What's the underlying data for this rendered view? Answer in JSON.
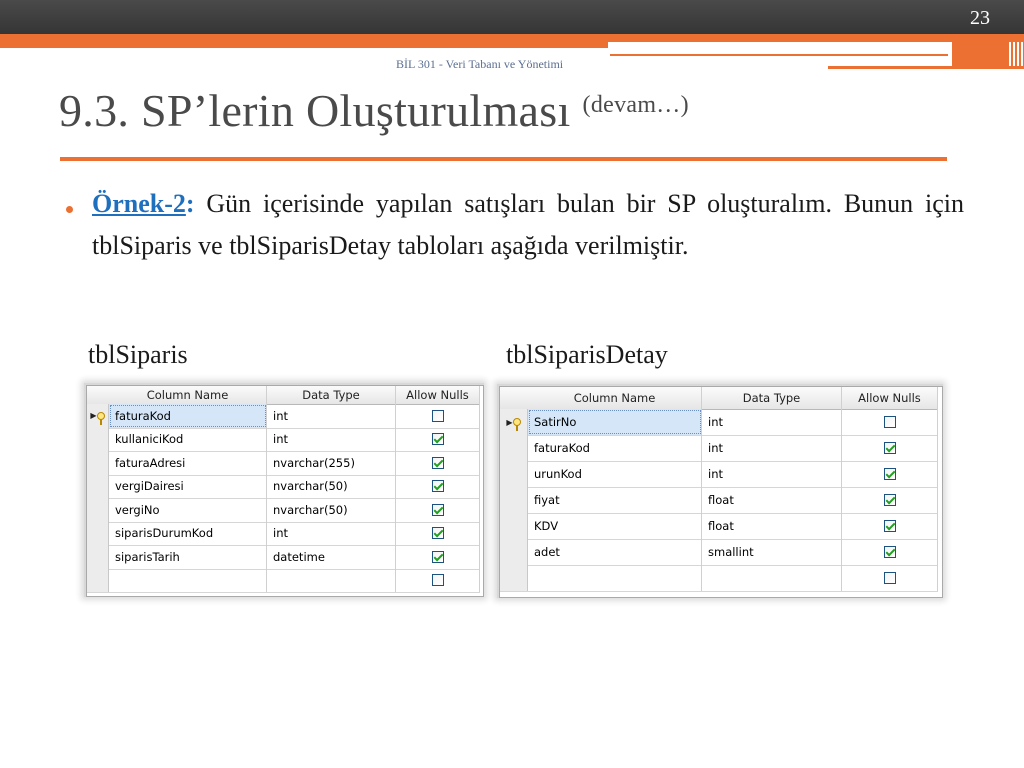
{
  "slide": {
    "page_number": "23",
    "course": "BİL 301 - Veri Tabanı ve Yönetimi",
    "title": "9.3. SP’lerin Oluşturulması",
    "title_sub": "(devam…)",
    "bullet_lead": "Örnek-2",
    "bullet_colon": ":",
    "bullet_text": " Gün içerisinde yapılan satışları bulan bir SP oluşturalım. Bunun için tblSiparis ve tblSiparisDetay tabloları aşağıda verilmiştir."
  },
  "colors": {
    "accent": "#ec7032",
    "header_bar": "#3f3f3f",
    "link": "#1f6fbf",
    "title": "#4a4a4a"
  },
  "tables": [
    {
      "caption": "tblSiparis",
      "headers": [
        "Column Name",
        "Data Type",
        "Allow Nulls"
      ],
      "rows": [
        {
          "name": "faturaKod",
          "type": "int",
          "nulls": false,
          "pk": true
        },
        {
          "name": "kullaniciKod",
          "type": "int",
          "nulls": true
        },
        {
          "name": "faturaAdresi",
          "type": "nvarchar(255)",
          "nulls": true
        },
        {
          "name": "vergiDairesi",
          "type": "nvarchar(50)",
          "nulls": true
        },
        {
          "name": "vergiNo",
          "type": "nvarchar(50)",
          "nulls": true
        },
        {
          "name": "siparisDurumKod",
          "type": "int",
          "nulls": true
        },
        {
          "name": "siparisTarih",
          "type": "datetime",
          "nulls": true
        },
        {
          "name": "",
          "type": "",
          "nulls": false
        }
      ]
    },
    {
      "caption": "tblSiparisDetay",
      "headers": [
        "Column Name",
        "Data Type",
        "Allow Nulls"
      ],
      "rows": [
        {
          "name": "SatirNo",
          "type": "int",
          "nulls": false,
          "pk": true
        },
        {
          "name": "faturaKod",
          "type": "int",
          "nulls": true
        },
        {
          "name": "urunKod",
          "type": "int",
          "nulls": true
        },
        {
          "name": "fiyat",
          "type": "float",
          "nulls": true
        },
        {
          "name": "KDV",
          "type": "float",
          "nulls": true
        },
        {
          "name": "adet",
          "type": "smallint",
          "nulls": true
        },
        {
          "name": "",
          "type": "",
          "nulls": false
        }
      ]
    }
  ]
}
